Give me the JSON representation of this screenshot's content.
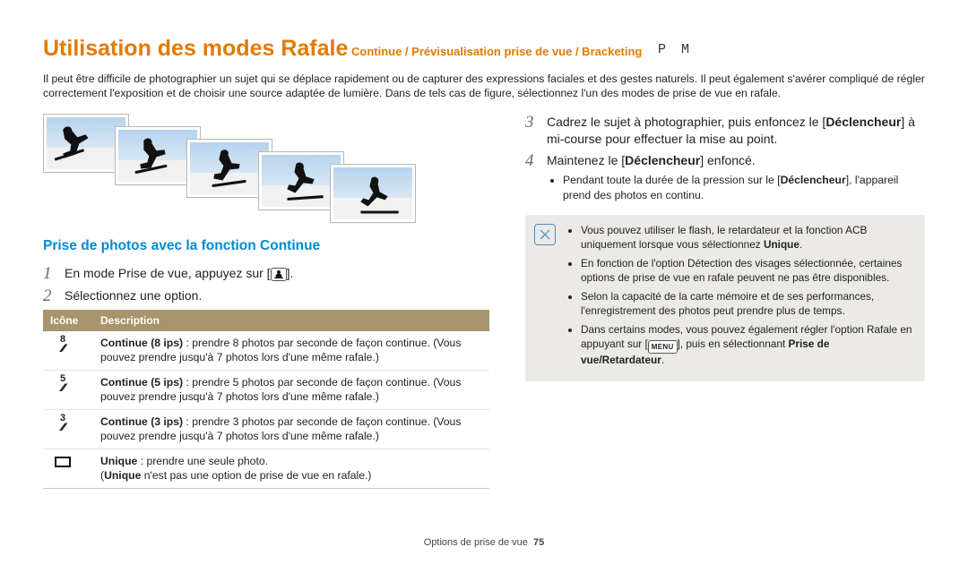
{
  "title": {
    "main": "Utilisation des modes Rafale",
    "sub": "Continue / Prévisualisation prise de vue / Bracketing",
    "modes": "P M"
  },
  "intro": "Il peut être difficile de photographier un sujet qui se déplace rapidement ou de capturer des expressions faciales et des gestes naturels. Il peut également s'avérer compliqué de régler correctement l'exposition et de choisir une source adaptée de lumière. Dans de tels cas de figure, sélectionnez l'un des modes de prise de vue en rafale.",
  "section_heading": "Prise de photos avec la fonction Continue",
  "left_steps": {
    "s1_pre": "En mode Prise de vue, appuyez sur [",
    "s1_post": "].",
    "s1_icon": "burst-mode-icon",
    "s2": "Sélectionnez une option."
  },
  "table": {
    "head_icon": "Icône",
    "head_desc": "Description",
    "r1_digit": "8",
    "r1": "<b>Continue (8 ips)</b> : prendre 8 photos par seconde de façon continue. (Vous pouvez prendre jusqu'à 7 photos lors d'une même rafale.)",
    "r2_digit": "5",
    "r2": "<b>Continue (5 ips)</b> : prendre 5 photos par seconde de façon continue. (Vous pouvez prendre jusqu'à 7 photos lors d'une même rafale.)",
    "r3_digit": "3",
    "r3": "<b>Continue (3 ips)</b> : prendre 3 photos par seconde de façon continue. (Vous pouvez prendre jusqu'à 7 photos lors d'une même rafale.)",
    "r4": "<b>Unique</b> : prendre une seule photo.<br>(<b>Unique</b> n'est pas une option de prise de vue en rafale.)"
  },
  "right_steps": {
    "s3_a": "Cadrez le sujet à photographier, puis enfoncez le [",
    "s3_bold1": "Déclencheur",
    "s3_b": "] à mi-course pour effectuer la mise au point.",
    "s4_a": "Maintenez le [",
    "s4_bold": "Déclencheur",
    "s4_b": "] enfoncé.",
    "s4_sub_a": "Pendant toute la durée de la pression sur le [",
    "s4_sub_bold": "Déclencheur",
    "s4_sub_b": "], l'appareil prend des photos en continu."
  },
  "note": {
    "b1_a": "Vous pouvez utiliser le flash, le retardateur et la fonction ACB uniquement lorsque vous sélectionnez ",
    "b1_bold": "Unique",
    "b1_b": ".",
    "b2": "En fonction de l'option Détection des visages sélectionnée, certaines options de prise de vue en rafale peuvent ne pas être disponibles.",
    "b3": "Selon la capacité de la carte mémoire et de ses performances, l'enregistrement des photos peut prendre plus de temps.",
    "b4_a": "Dans certains modes, vous pouvez également régler l'option Rafale en appuyant sur [",
    "b4_menu": "MENU",
    "b4_b": "], puis en sélectionnant ",
    "b4_bold": "Prise de vue/Retardateur",
    "b4_c": "."
  },
  "footer": {
    "section": "Options de prise de vue",
    "page": "75"
  }
}
